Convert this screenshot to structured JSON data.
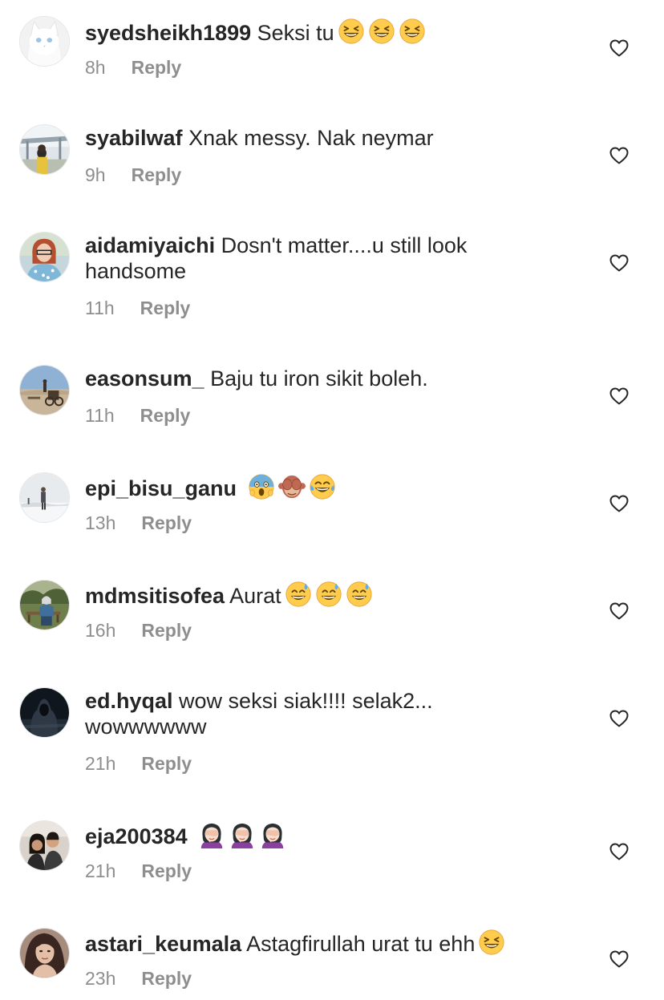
{
  "reply_label": "Reply",
  "comments": [
    {
      "username": "syedsheikh1899",
      "text": "Seksi tu",
      "emoji": [
        "laugh",
        "laugh",
        "laugh"
      ],
      "time": "8h",
      "avatar": "white-cat"
    },
    {
      "username": "syabilwaf",
      "text": "Xnak messy. Nak neymar",
      "emoji": [],
      "time": "9h",
      "avatar": "outdoor"
    },
    {
      "username": "aidamiyaichi",
      "text": "Dosn't matter....u still look handsome",
      "emoji": [],
      "time": "11h",
      "avatar": "woman-red-hair"
    },
    {
      "username": "easonsum_",
      "text": "Baju tu iron sikit boleh.",
      "emoji": [],
      "time": "11h",
      "avatar": "desert"
    },
    {
      "username": "epi_bisu_ganu",
      "text": "",
      "emoji": [
        "scream",
        "see-no-evil-monkey",
        "tears-of-joy"
      ],
      "time": "13h",
      "avatar": "snow"
    },
    {
      "username": "mdmsitisofea",
      "text": "Aurat",
      "emoji": [
        "sweat-smile",
        "sweat-smile",
        "sweat-smile"
      ],
      "time": "16h",
      "avatar": "park"
    },
    {
      "username": "ed.hyqal",
      "text": "wow seksi siak!!!! selak2... wowwwwww",
      "emoji": [],
      "time": "21h",
      "avatar": "hoodie-dark"
    },
    {
      "username": "eja200384",
      "text": "",
      "emoji": [
        "facepalm-woman",
        "facepalm-woman",
        "facepalm-woman"
      ],
      "time": "21h",
      "avatar": "couple"
    },
    {
      "username": "astari_keumala",
      "text": "Astagfirullah urat tu ehh",
      "emoji": [
        "laugh"
      ],
      "time": "23h",
      "avatar": "portrait"
    }
  ]
}
